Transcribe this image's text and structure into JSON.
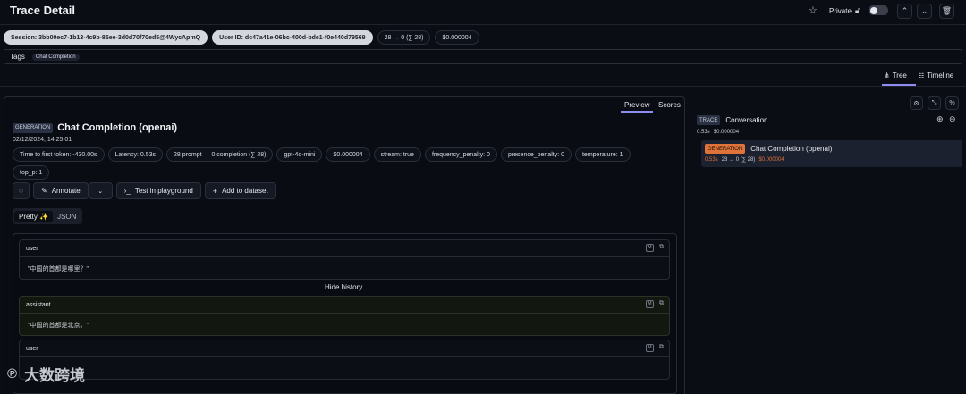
{
  "page": {
    "title": "Trace Detail"
  },
  "header": {
    "private_label": "Private"
  },
  "trace_pills": [
    "Session: 3bb00ec7-1b13-4c9b-85ee-3d0d70f70ed5@4WycApmQ",
    "User ID: dc47a41e-06bc-400d-bde1-f0e440d79569",
    "28 → 0 (∑ 28)",
    "$0.000004"
  ],
  "tags": {
    "label": "Tags",
    "items": [
      "Chat Completion"
    ]
  },
  "view_toggle": {
    "tree": "Tree",
    "timeline": "Timeline"
  },
  "detail_tabs": {
    "preview": "Preview",
    "scores": "Scores"
  },
  "observation": {
    "type_badge": "GENERATION",
    "title": "Chat Completion (openai)",
    "timestamp": "02/12/2024, 14:25:01",
    "metrics": [
      "Time to first token: -430.00s",
      "Latency: 0.53s",
      "28 prompt → 0 completion (∑ 28)",
      "gpt-4o-mini",
      "$0.000004",
      "stream: true",
      "frequency_penalty: 0",
      "presence_penalty: 0",
      "temperature: 1",
      "top_p: 1"
    ]
  },
  "actions": {
    "annotate": "Annotate",
    "playground": "Test in playground",
    "dataset": "Add to dataset"
  },
  "format_toggle": {
    "pretty": "Pretty ✨",
    "json": "JSON"
  },
  "messages": [
    {
      "role": "user",
      "content": "\"中国的首都是哪里？\""
    },
    {
      "role": "assistant",
      "content": "\"中国的首都是北京。\""
    },
    {
      "role": "user",
      "content": ""
    }
  ],
  "hide_history": "Hide history",
  "tree": {
    "root": {
      "badge": "TRACE",
      "name": "Conversation",
      "latency": "0.53s",
      "cost": "$0.000004"
    },
    "child": {
      "badge": "GENERATION",
      "name": "Chat Completion (openai)",
      "latency": "0.53s",
      "tokens": "28 → 0 (∑ 28)",
      "cost": "$0.000004"
    }
  },
  "watermark": {
    "text": "大数跨境"
  },
  "colors": {
    "accent_orange": "#e0733a",
    "assistant_bg": "#141a12",
    "selected_row": "#1c2130"
  }
}
